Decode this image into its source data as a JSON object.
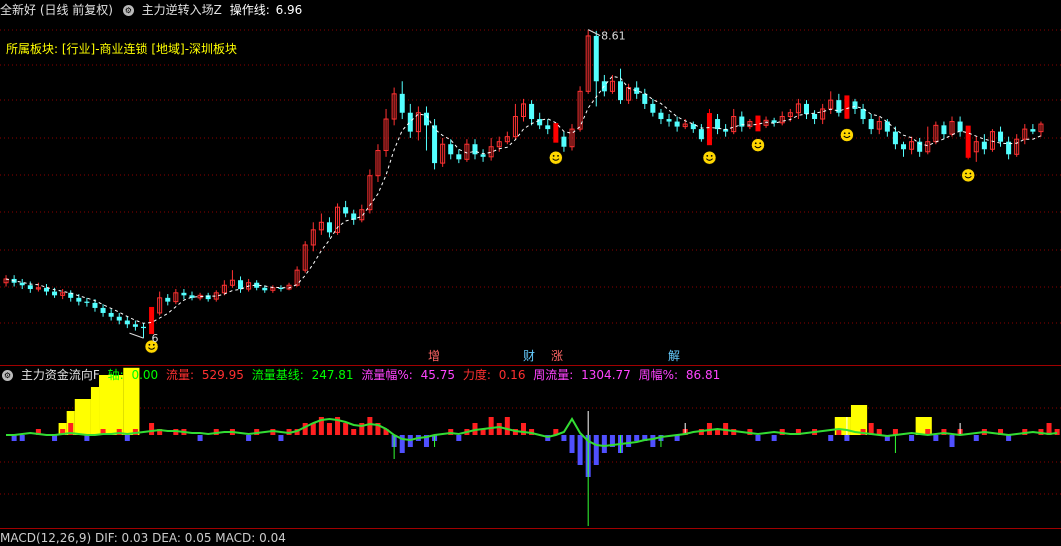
{
  "header": {
    "stock": "全新好 (日线 前复权)",
    "indicator": "主力逆转入场Z",
    "op_label": "操作线:",
    "op_value": "6.96"
  },
  "sector": {
    "text": "所属板块: [行业]-商业连锁 [地域]-深圳板块"
  },
  "price_annotations": {
    "high": "8.61",
    "low": "6"
  },
  "events": [
    {
      "label": "增",
      "color": "#ff6666"
    },
    {
      "label": "财",
      "color": "#66ccff"
    },
    {
      "label": "涨",
      "color": "#ff6666"
    },
    {
      "label": "解",
      "color": "#66ccff"
    }
  ],
  "flow_header": {
    "title": "主力资金流向F",
    "axis_label": "轴:",
    "axis_value": "0.00",
    "flow_label": "流量:",
    "flow_value": "529.95",
    "base_label": "流量基线:",
    "base_value": "247.81",
    "amp_label": "流量幅%:",
    "amp_value": "45.75",
    "force_label": "力度:",
    "force_value": "0.16",
    "week_label": "周流量:",
    "week_value": "1304.77",
    "weekamp_label": "周幅%:",
    "weekamp_value": "86.81"
  },
  "macd_header": {
    "text": "MACD(12,26,9)  DIF: 0.03  DEA: 0.05  MACD: 0.04"
  },
  "colors": {
    "up": "#ff3232",
    "down": "#54ffff",
    "signal": "#ff0000",
    "flow_pos": "#ff2020",
    "flow_neg": "#5050ff",
    "flow_big": "#ffff00",
    "flow_line": "#33dd33",
    "grid": "#8b0000",
    "smile": "#ffd700"
  },
  "chart_data": {
    "type": "candlestick",
    "candles": [
      [
        6.6,
        6.63,
        6.66,
        6.57
      ],
      [
        6.63,
        6.6,
        6.66,
        6.57
      ],
      [
        6.6,
        6.58,
        6.63,
        6.55
      ],
      [
        6.58,
        6.55,
        6.61,
        6.52
      ],
      [
        6.55,
        6.56,
        6.6,
        6.53
      ],
      [
        6.56,
        6.53,
        6.59,
        6.5
      ],
      [
        6.53,
        6.5,
        6.56,
        6.48
      ],
      [
        6.5,
        6.52,
        6.55,
        6.47
      ],
      [
        6.52,
        6.48,
        6.54,
        6.45
      ],
      [
        6.48,
        6.45,
        6.51,
        6.42
      ],
      [
        6.45,
        6.44,
        6.48,
        6.41
      ],
      [
        6.44,
        6.4,
        6.47,
        6.37
      ],
      [
        6.4,
        6.36,
        6.43,
        6.33
      ],
      [
        6.36,
        6.33,
        6.39,
        6.3
      ],
      [
        6.33,
        6.3,
        6.36,
        6.27
      ],
      [
        6.3,
        6.27,
        6.33,
        6.24
      ],
      [
        6.27,
        6.25,
        6.3,
        6.22
      ],
      [
        6.25,
        6.24,
        6.28,
        6.16
      ],
      [
        6.24,
        6.36,
        6.38,
        6.22
      ],
      [
        6.36,
        6.48,
        6.53,
        6.34
      ],
      [
        6.48,
        6.45,
        6.51,
        6.42
      ],
      [
        6.45,
        6.52,
        6.55,
        6.43
      ],
      [
        6.52,
        6.5,
        6.55,
        6.47
      ],
      [
        6.5,
        6.48,
        6.53,
        6.46
      ],
      [
        6.48,
        6.5,
        6.52,
        6.46
      ],
      [
        6.5,
        6.47,
        6.52,
        6.45
      ],
      [
        6.47,
        6.52,
        6.54,
        6.45
      ],
      [
        6.52,
        6.58,
        6.62,
        6.5
      ],
      [
        6.58,
        6.62,
        6.7,
        6.56
      ],
      [
        6.62,
        6.55,
        6.65,
        6.52
      ],
      [
        6.55,
        6.6,
        6.63,
        6.53
      ],
      [
        6.6,
        6.56,
        6.62,
        6.54
      ],
      [
        6.56,
        6.54,
        6.58,
        6.52
      ],
      [
        6.54,
        6.56,
        6.58,
        6.52
      ],
      [
        6.56,
        6.55,
        6.58,
        6.53
      ],
      [
        6.55,
        6.58,
        6.6,
        6.54
      ],
      [
        6.58,
        6.7,
        6.73,
        6.57
      ],
      [
        6.7,
        6.9,
        6.93,
        6.68
      ],
      [
        6.9,
        7.02,
        7.08,
        6.85
      ],
      [
        7.02,
        7.08,
        7.15,
        6.98
      ],
      [
        7.08,
        7.0,
        7.12,
        6.96
      ],
      [
        7.0,
        7.2,
        7.23,
        6.98
      ],
      [
        7.2,
        7.15,
        7.25,
        7.12
      ],
      [
        7.15,
        7.1,
        7.18,
        7.06
      ],
      [
        7.1,
        7.18,
        7.22,
        7.08
      ],
      [
        7.18,
        7.45,
        7.5,
        7.15
      ],
      [
        7.45,
        7.65,
        7.7,
        7.4
      ],
      [
        7.65,
        7.9,
        7.98,
        7.6
      ],
      [
        7.9,
        8.1,
        8.15,
        7.85
      ],
      [
        8.1,
        7.95,
        8.2,
        7.9
      ],
      [
        7.95,
        7.8,
        8.02,
        7.75
      ],
      [
        7.8,
        7.95,
        8.0,
        7.73
      ],
      [
        7.95,
        7.85,
        8.0,
        7.65
      ],
      [
        7.85,
        7.55,
        7.9,
        7.5
      ],
      [
        7.55,
        7.7,
        7.75,
        7.52
      ],
      [
        7.7,
        7.62,
        7.74,
        7.58
      ],
      [
        7.62,
        7.58,
        7.66,
        7.55
      ],
      [
        7.58,
        7.7,
        7.74,
        7.56
      ],
      [
        7.7,
        7.62,
        7.74,
        7.58
      ],
      [
        7.62,
        7.6,
        7.66,
        7.56
      ],
      [
        7.6,
        7.68,
        7.75,
        7.57
      ],
      [
        7.68,
        7.72,
        7.76,
        7.64
      ],
      [
        7.72,
        7.76,
        7.8,
        7.7
      ],
      [
        7.76,
        7.92,
        8.02,
        7.74
      ],
      [
        7.92,
        8.02,
        8.06,
        7.88
      ],
      [
        8.02,
        7.9,
        8.05,
        7.85
      ],
      [
        7.9,
        7.85,
        7.95,
        7.82
      ],
      [
        7.85,
        7.82,
        7.9,
        7.78
      ],
      [
        7.82,
        7.76,
        7.85,
        7.72
      ],
      [
        7.76,
        7.68,
        7.8,
        7.64
      ],
      [
        7.68,
        7.82,
        7.86,
        7.65
      ],
      [
        7.82,
        8.12,
        8.16,
        7.8
      ],
      [
        8.12,
        8.56,
        8.61,
        8.1
      ],
      [
        8.56,
        8.2,
        8.6,
        8.0
      ],
      [
        8.2,
        8.12,
        8.25,
        8.08
      ],
      [
        8.12,
        8.2,
        8.25,
        8.1
      ],
      [
        8.2,
        8.05,
        8.3,
        8.02
      ],
      [
        8.05,
        8.15,
        8.18,
        8.02
      ],
      [
        8.15,
        8.1,
        8.2,
        8.06
      ],
      [
        8.1,
        8.02,
        8.14,
        7.98
      ],
      [
        8.02,
        7.95,
        8.06,
        7.92
      ],
      [
        7.95,
        7.9,
        7.98,
        7.86
      ],
      [
        7.9,
        7.88,
        7.94,
        7.84
      ],
      [
        7.88,
        7.84,
        7.92,
        7.8
      ],
      [
        7.84,
        7.86,
        7.9,
        7.82
      ],
      [
        7.86,
        7.82,
        7.88,
        7.79
      ],
      [
        7.82,
        7.74,
        7.86,
        7.72
      ],
      [
        7.74,
        7.9,
        7.98,
        7.72
      ],
      [
        7.9,
        7.82,
        7.94,
        7.78
      ],
      [
        7.82,
        7.8,
        7.86,
        7.76
      ],
      [
        7.8,
        7.92,
        7.98,
        7.78
      ],
      [
        7.92,
        7.84,
        7.96,
        7.8
      ],
      [
        7.84,
        7.88,
        7.9,
        7.82
      ],
      [
        7.88,
        7.85,
        7.9,
        7.82
      ],
      [
        7.85,
        7.89,
        7.92,
        7.83
      ],
      [
        7.89,
        7.87,
        7.91,
        7.84
      ],
      [
        7.87,
        7.92,
        7.96,
        7.85
      ],
      [
        7.92,
        7.95,
        7.98,
        7.88
      ],
      [
        7.95,
        8.02,
        8.06,
        7.9
      ],
      [
        8.02,
        7.94,
        8.05,
        7.9
      ],
      [
        7.94,
        7.9,
        7.97,
        7.86
      ],
      [
        7.9,
        7.98,
        8.02,
        7.86
      ],
      [
        7.98,
        8.05,
        8.12,
        7.94
      ],
      [
        8.05,
        7.95,
        8.1,
        7.92
      ],
      [
        7.95,
        8.04,
        8.08,
        7.9
      ],
      [
        8.04,
        7.98,
        8.06,
        7.94
      ],
      [
        7.98,
        7.9,
        8.02,
        7.86
      ],
      [
        7.9,
        7.82,
        7.94,
        7.78
      ],
      [
        7.82,
        7.88,
        7.92,
        7.78
      ],
      [
        7.88,
        7.8,
        7.9,
        7.76
      ],
      [
        7.8,
        7.7,
        7.84,
        7.66
      ],
      [
        7.7,
        7.66,
        7.72,
        7.6
      ],
      [
        7.66,
        7.72,
        7.76,
        7.62
      ],
      [
        7.72,
        7.64,
        7.75,
        7.6
      ],
      [
        7.64,
        7.72,
        7.84,
        7.62
      ],
      [
        7.72,
        7.85,
        7.88,
        7.7
      ],
      [
        7.85,
        7.78,
        7.88,
        7.74
      ],
      [
        7.78,
        7.88,
        7.92,
        7.76
      ],
      [
        7.88,
        7.8,
        7.92,
        7.76
      ],
      [
        7.8,
        7.64,
        7.84,
        7.58
      ],
      [
        7.64,
        7.72,
        7.76,
        7.56
      ],
      [
        7.72,
        7.66,
        7.78,
        7.62
      ],
      [
        7.66,
        7.8,
        7.82,
        7.64
      ],
      [
        7.8,
        7.72,
        7.84,
        7.68
      ],
      [
        7.72,
        7.62,
        7.76,
        7.58
      ],
      [
        7.62,
        7.74,
        7.78,
        7.6
      ],
      [
        7.74,
        7.82,
        7.86,
        7.7
      ],
      [
        7.82,
        7.8,
        7.86,
        7.78
      ],
      [
        7.8,
        7.86,
        7.88,
        7.76
      ]
    ],
    "signal_candles": [
      18,
      68,
      87,
      93,
      104,
      119
    ],
    "flow_bars": [
      0,
      -1,
      -1,
      0,
      1,
      0,
      -1,
      1,
      2,
      0,
      -1,
      0,
      1,
      0,
      1,
      -1,
      1,
      0,
      2,
      1,
      0,
      1,
      1,
      0,
      -1,
      0,
      1,
      0,
      1,
      0,
      -1,
      1,
      0,
      1,
      -1,
      1,
      1,
      2,
      2,
      3,
      2,
      3,
      2,
      1,
      2,
      3,
      2,
      1,
      -2,
      -3,
      -2,
      -1,
      -2,
      -1,
      0,
      1,
      -1,
      1,
      2,
      1,
      3,
      2,
      3,
      1,
      2,
      1,
      0,
      -1,
      1,
      -1,
      -3,
      -5,
      -7,
      -5,
      -3,
      -2,
      -3,
      -2,
      -1,
      -1,
      -2,
      -1,
      0,
      -1,
      1,
      0,
      1,
      2,
      1,
      2,
      1,
      0,
      1,
      -1,
      0,
      -1,
      1,
      0,
      1,
      0,
      1,
      0,
      -1,
      1,
      -1,
      0,
      1,
      2,
      1,
      -1,
      1,
      0,
      -1,
      0,
      1,
      -1,
      1,
      -2,
      1,
      0,
      -1,
      1,
      0,
      1,
      -1,
      0,
      1,
      0,
      1,
      2,
      1,
      0,
      1
    ],
    "flow_line": [
      0,
      0,
      0.1,
      0.2,
      0.1,
      0,
      0,
      0.1,
      0.2,
      0.1,
      0,
      0,
      0.1,
      0.1,
      0.2,
      0.1,
      0.2,
      0.3,
      0.4,
      0.5,
      0.4,
      0.4,
      0.3,
      0.2,
      0.2,
      0.1,
      0.2,
      0.3,
      0.3,
      0.2,
      0.1,
      0.2,
      0.3,
      0.4,
      0.3,
      0.2,
      0.4,
      0.8,
      1.2,
      1.5,
      1.6,
      1.5,
      1.3,
      1.0,
      0.9,
      1.1,
      1.0,
      0.6,
      0,
      -0.4,
      -0.5,
      -0.3,
      -0.2,
      0,
      0.1,
      0.2,
      0.1,
      0.3,
      0.5,
      0.6,
      0.7,
      0.8,
      0.6,
      0.4,
      0.3,
      0.2,
      0,
      -0.2,
      0,
      0.3,
      1.6,
      0.2,
      -0.6,
      -1.0,
      -1.1,
      -1.0,
      -0.9,
      -0.8,
      -0.7,
      -0.5,
      -0.4,
      -0.2,
      -0.1,
      0,
      0.1,
      0.3,
      0.4,
      0.5,
      0.6,
      0.5,
      0.4,
      0.3,
      0.2,
      0.1,
      0.2,
      0.3,
      0.2,
      0.1,
      0.1,
      0.2,
      0.3,
      0.4,
      0.5,
      0.6,
      0.5,
      0.3,
      0.2,
      0.1,
      0,
      -0.1,
      0,
      0.1,
      0.2,
      0.1,
      0,
      0.1,
      0.2,
      0.1,
      0,
      0.1,
      0.2,
      0.3,
      0.2,
      0.1,
      0,
      0.1,
      0.2,
      0.3,
      0.2,
      0.1,
      0.2
    ],
    "big_blocks": [
      {
        "from": 7,
        "to": 7,
        "h": 1
      },
      {
        "from": 8,
        "to": 8,
        "h": 2
      },
      {
        "from": 9,
        "to": 10,
        "h": 3
      },
      {
        "from": 11,
        "to": 11,
        "h": 4
      },
      {
        "from": 12,
        "to": 14,
        "h": 5
      },
      {
        "from": 15,
        "to": 16,
        "h": 5.6
      },
      {
        "from": 103,
        "to": 104,
        "h": 1.5
      },
      {
        "from": 105,
        "to": 106,
        "h": 2.5
      },
      {
        "from": 113,
        "to": 114,
        "h": 1.5
      }
    ]
  }
}
